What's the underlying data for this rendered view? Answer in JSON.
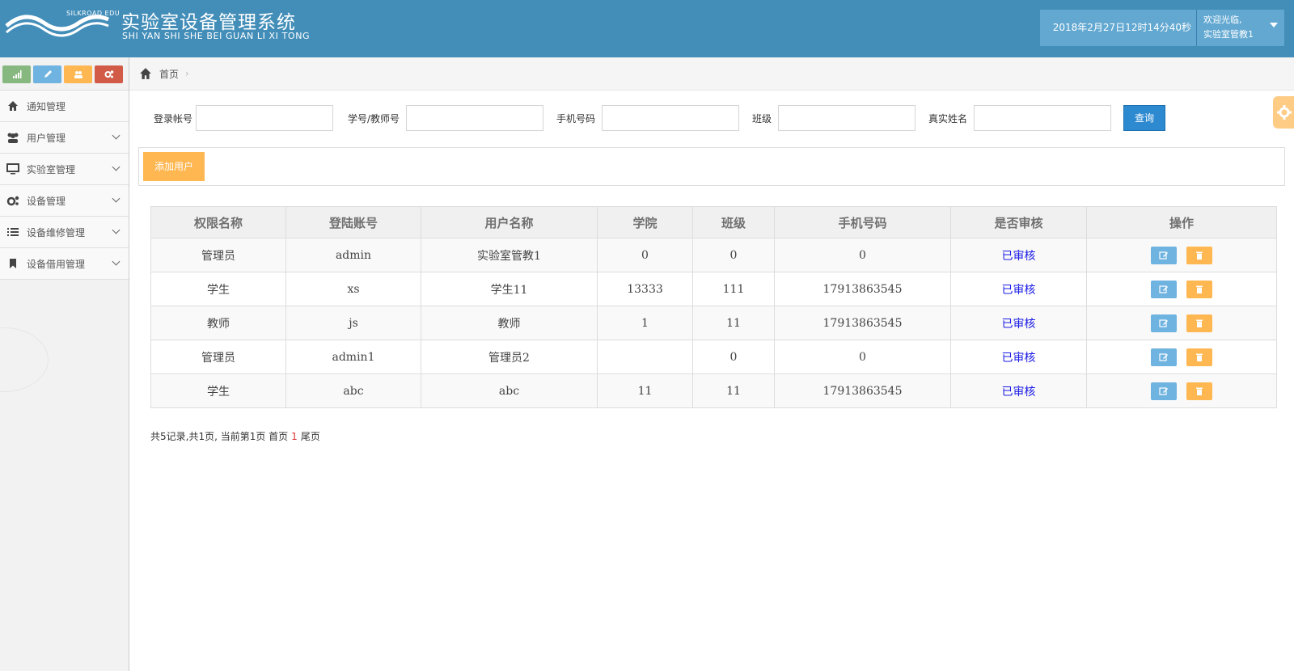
{
  "header": {
    "logo_text": "SILKROAD EDU",
    "title": "实验室设备管理系统",
    "subtitle": "SHI YAN SHI SHE BEI GUAN LI XI TONG",
    "datetime": "2018年2月27日12时14分40秒",
    "welcome": "欢迎光临,",
    "username": "实验室管教1"
  },
  "sidebar": {
    "items": [
      {
        "label": "通知管理"
      },
      {
        "label": "用户管理"
      },
      {
        "label": "实验室管理"
      },
      {
        "label": "设备管理"
      },
      {
        "label": "设备维修管理"
      },
      {
        "label": "设备借用管理"
      }
    ]
  },
  "breadcrumb": {
    "home": "首页"
  },
  "search": {
    "login_label": "登录帐号",
    "id_label": "学号/教师号",
    "phone_label": "手机号码",
    "class_label": "班级",
    "name_label": "真实姓名",
    "query_label": "查询"
  },
  "add_user_label": "添加用户",
  "table": {
    "headers": [
      "权限名称",
      "登陆账号",
      "用户名称",
      "学院",
      "班级",
      "手机号码",
      "是否审核",
      "操作"
    ],
    "rows": [
      [
        "管理员",
        "admin",
        "实验室管教1",
        "0",
        "0",
        "0",
        "已审核"
      ],
      [
        "学生",
        "xs",
        "学生11",
        "13333",
        "111",
        "17913863545",
        "已审核"
      ],
      [
        "教师",
        "js",
        "教师",
        "1",
        "11",
        "17913863545",
        "已审核"
      ],
      [
        "管理员",
        "admin1",
        "管理员2",
        "",
        "0",
        "0",
        "已审核"
      ],
      [
        "学生",
        "abc",
        "abc",
        "11",
        "11",
        "17913863545",
        "已审核"
      ]
    ]
  },
  "pager": {
    "summary": "共5记录,共1页, 当前第1页 首页",
    "current": "1",
    "last": "尾页"
  }
}
